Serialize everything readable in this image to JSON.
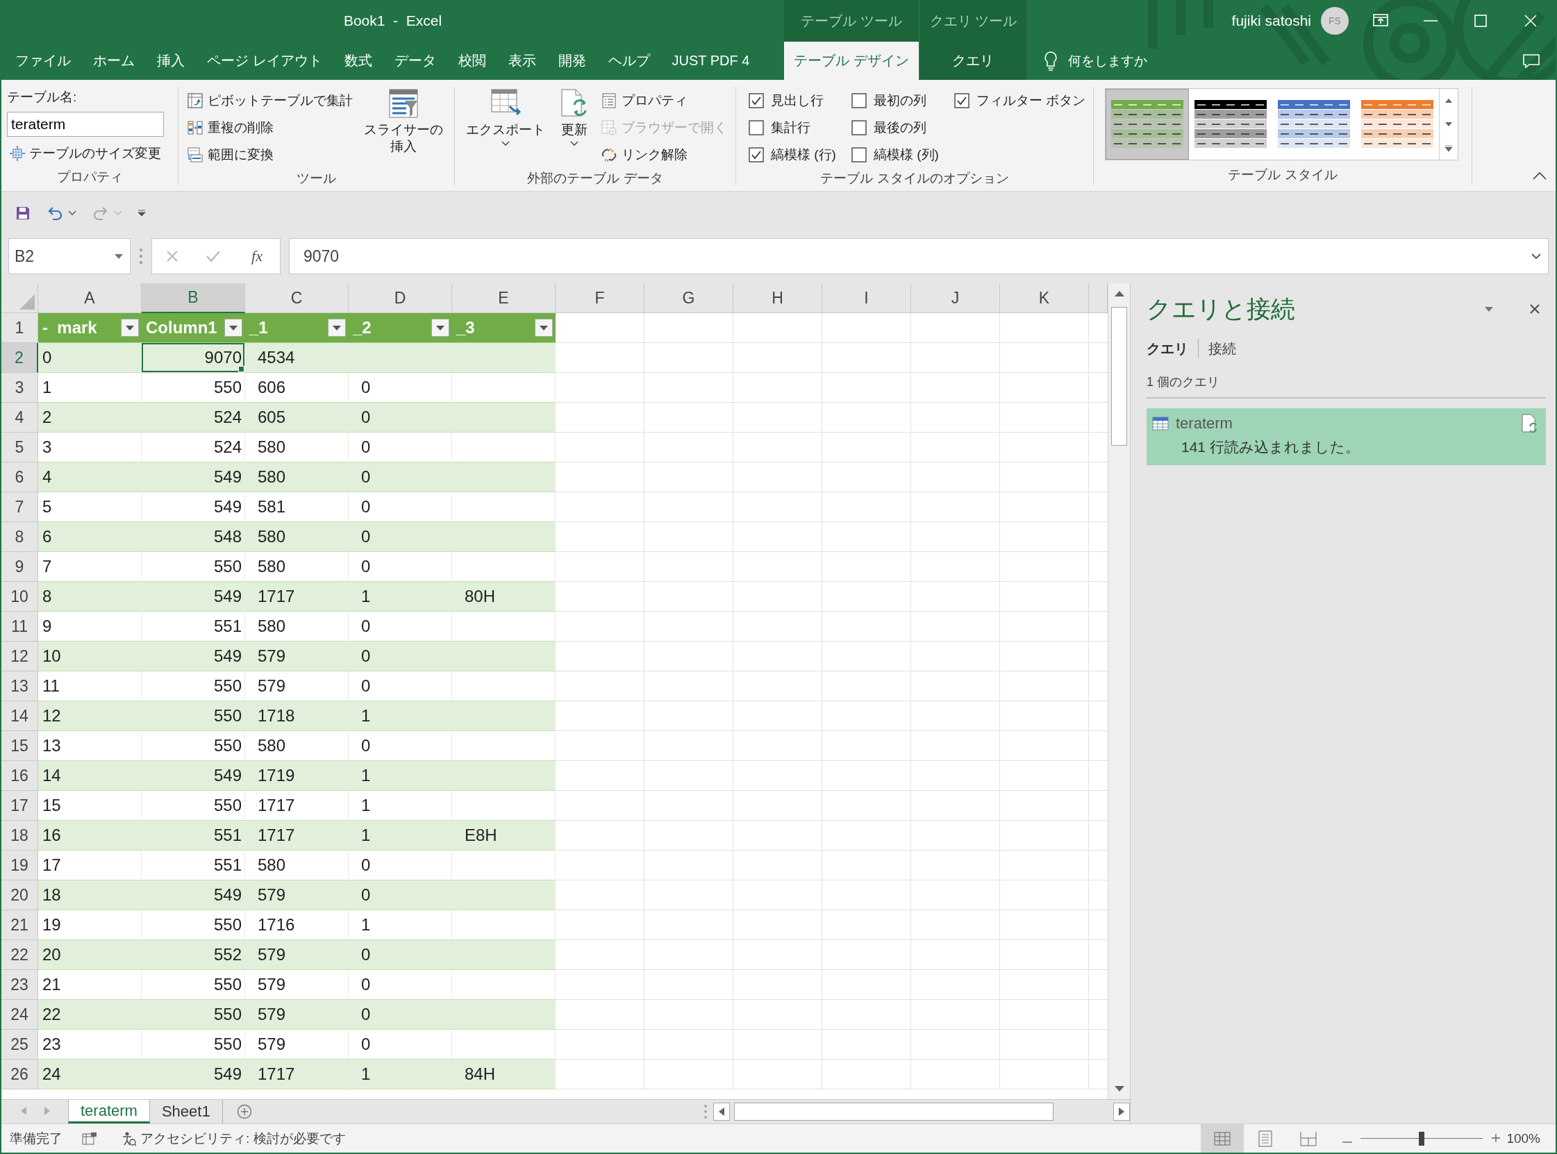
{
  "window": {
    "title": "Book1  -  Excel",
    "user_name": "fujiki satoshi",
    "avatar_initials": "FS"
  },
  "ribbon_tabs": [
    {
      "label": "ファイル",
      "selected": false
    },
    {
      "label": "ホーム",
      "selected": false
    },
    {
      "label": "挿入",
      "selected": false
    },
    {
      "label": "ページ レイアウト",
      "selected": false
    },
    {
      "label": "数式",
      "selected": false
    },
    {
      "label": "データ",
      "selected": false
    },
    {
      "label": "校閲",
      "selected": false
    },
    {
      "label": "表示",
      "selected": false
    },
    {
      "label": "開発",
      "selected": false
    },
    {
      "label": "ヘルプ",
      "selected": false
    },
    {
      "label": "JUST PDF 4",
      "selected": false
    }
  ],
  "context_groups": [
    {
      "label": "テーブル ツール",
      "tabs": [
        {
          "label": "テーブル デザイン",
          "selected": true
        }
      ]
    },
    {
      "label": "クエリ ツール",
      "tabs": [
        {
          "label": "クエリ",
          "selected": false
        }
      ]
    }
  ],
  "tell_me": {
    "placeholder": "何をしますか"
  },
  "ribbon_groups": [
    {
      "kind": "table_name",
      "label": "プロパティ",
      "field_label": "テーブル名:",
      "field_value": "teraterm",
      "button": "テーブルのサイズ変更"
    },
    {
      "kind": "commands",
      "label": "ツール",
      "items": [
        {
          "kind": "small",
          "label": "ピボットテーブルで集計",
          "disabled": false
        },
        {
          "kind": "small",
          "label": "重複の削除",
          "disabled": false
        },
        {
          "kind": "small",
          "label": "範囲に変換",
          "disabled": false
        },
        {
          "kind": "large",
          "lines": [
            "スライサーの",
            "挿入"
          ],
          "menu": false
        }
      ]
    },
    {
      "kind": "commands",
      "label": "外部のテーブル データ",
      "items": [
        {
          "kind": "large",
          "lines": [
            "エクスポート"
          ],
          "menu": true
        },
        {
          "kind": "large",
          "lines": [
            "更新"
          ],
          "menu": true
        },
        {
          "kind": "small",
          "label": "プロパティ",
          "disabled": false
        },
        {
          "kind": "small",
          "label": "ブラウザーで開く",
          "disabled": true
        },
        {
          "kind": "small",
          "label": "リンク解除",
          "disabled": false
        }
      ]
    },
    {
      "kind": "options",
      "label": "テーブル スタイルのオプション",
      "options": [
        {
          "label": "見出し行",
          "checked": true
        },
        {
          "label": "集計行",
          "checked": false
        },
        {
          "label": "縞模様 (行)",
          "checked": true
        },
        {
          "label": "最初の列",
          "checked": false
        },
        {
          "label": "最後の列",
          "checked": false
        },
        {
          "label": "縞模様 (列)",
          "checked": false
        },
        {
          "label": "フィルター ボタン",
          "checked": true
        }
      ]
    },
    {
      "kind": "gallery",
      "label": "テーブル スタイル",
      "styles": [
        {
          "color": "#70ad47",
          "selected": true
        },
        {
          "color": "#000000",
          "selected": false
        },
        {
          "color": "#4472c4",
          "selected": false
        },
        {
          "color": "#ed7d31",
          "selected": false
        }
      ]
    }
  ],
  "quick_access": [
    {
      "kind": "save",
      "disabled": false
    },
    {
      "kind": "undo",
      "disabled": false
    },
    {
      "kind": "redo",
      "disabled": true
    },
    {
      "kind": "customize",
      "disabled": false
    }
  ],
  "formula_bar": {
    "name_box": "B2",
    "function_button": "fx",
    "formula": "9070"
  },
  "grid": {
    "columns": [
      {
        "letter": "A",
        "selected": false
      },
      {
        "letter": "B",
        "selected": true
      },
      {
        "letter": "C",
        "selected": false
      },
      {
        "letter": "D",
        "selected": false
      },
      {
        "letter": "E",
        "selected": false
      },
      {
        "letter": "F",
        "selected": false
      },
      {
        "letter": "G",
        "selected": false
      },
      {
        "letter": "H",
        "selected": false
      },
      {
        "letter": "I",
        "selected": false
      },
      {
        "letter": "J",
        "selected": false
      },
      {
        "letter": "K",
        "selected": false
      }
    ]
  },
  "table": {
    "header_row": "1",
    "columns": [
      {
        "header": "-  mark",
        "kind": "text"
      },
      {
        "header": "Column1",
        "kind": "number"
      },
      {
        "header": "_1",
        "kind": "text"
      },
      {
        "header": "_2",
        "kind": "text"
      },
      {
        "header": "_3",
        "kind": "text"
      }
    ],
    "rows": [
      {
        "number": "2",
        "selected": true,
        "cells": [
          "0",
          "9070",
          "4534"
        ]
      },
      {
        "number": "3",
        "selected": false,
        "cells": [
          "1",
          "550",
          "606",
          "0"
        ]
      },
      {
        "number": "4",
        "selected": false,
        "cells": [
          "2",
          "524",
          "605",
          "0"
        ]
      },
      {
        "number": "5",
        "selected": false,
        "cells": [
          "3",
          "524",
          "580",
          "0"
        ]
      },
      {
        "number": "6",
        "selected": false,
        "cells": [
          "4",
          "549",
          "580",
          "0"
        ]
      },
      {
        "number": "7",
        "selected": false,
        "cells": [
          "5",
          "549",
          "581",
          "0"
        ]
      },
      {
        "number": "8",
        "selected": false,
        "cells": [
          "6",
          "548",
          "580",
          "0"
        ]
      },
      {
        "number": "9",
        "selected": false,
        "cells": [
          "7",
          "550",
          "580",
          "0"
        ]
      },
      {
        "number": "10",
        "selected": false,
        "cells": [
          "8",
          "549",
          "1717",
          "1",
          "80H"
        ]
      },
      {
        "number": "11",
        "selected": false,
        "cells": [
          "9",
          "551",
          "580",
          "0"
        ]
      },
      {
        "number": "12",
        "selected": false,
        "cells": [
          "10",
          "549",
          "579",
          "0"
        ]
      },
      {
        "number": "13",
        "selected": false,
        "cells": [
          "11",
          "550",
          "579",
          "0"
        ]
      },
      {
        "number": "14",
        "selected": false,
        "cells": [
          "12",
          "550",
          "1718",
          "1"
        ]
      },
      {
        "number": "15",
        "selected": false,
        "cells": [
          "13",
          "550",
          "580",
          "0"
        ]
      },
      {
        "number": "16",
        "selected": false,
        "cells": [
          "14",
          "549",
          "1719",
          "1"
        ]
      },
      {
        "number": "17",
        "selected": false,
        "cells": [
          "15",
          "550",
          "1717",
          "1"
        ]
      },
      {
        "number": "18",
        "selected": false,
        "cells": [
          "16",
          "551",
          "1717",
          "1",
          "E8H"
        ]
      },
      {
        "number": "19",
        "selected": false,
        "cells": [
          "17",
          "551",
          "580",
          "0"
        ]
      },
      {
        "number": "20",
        "selected": false,
        "cells": [
          "18",
          "549",
          "579",
          "0"
        ]
      },
      {
        "number": "21",
        "selected": false,
        "cells": [
          "19",
          "550",
          "1716",
          "1"
        ]
      },
      {
        "number": "22",
        "selected": false,
        "cells": [
          "20",
          "552",
          "579",
          "0"
        ]
      },
      {
        "number": "23",
        "selected": false,
        "cells": [
          "21",
          "550",
          "579",
          "0"
        ]
      },
      {
        "number": "24",
        "selected": false,
        "cells": [
          "22",
          "550",
          "579",
          "0"
        ]
      },
      {
        "number": "25",
        "selected": false,
        "cells": [
          "23",
          "550",
          "579",
          "0"
        ]
      },
      {
        "number": "26",
        "selected": false,
        "cells": [
          "24",
          "549",
          "1717",
          "1",
          "84H"
        ]
      }
    ]
  },
  "sheet_tabs": [
    {
      "label": "teraterm",
      "selected": true
    },
    {
      "label": "Sheet1",
      "selected": false
    }
  ],
  "query_pane": {
    "title": "クエリと接続",
    "tabs": [
      {
        "label": "クエリ",
        "selected": true
      },
      {
        "label": "接続",
        "selected": false
      }
    ],
    "count": "1 個のクエリ",
    "queries": [
      {
        "name": "teraterm",
        "status": "141 行読み込まれました。"
      }
    ]
  },
  "status_bar": {
    "mode": "準備完了",
    "accessibility": "アクセシビリティ: 検討が必要です",
    "views": [
      {
        "kind": "normal",
        "selected": true
      },
      {
        "kind": "page_layout",
        "selected": false
      },
      {
        "kind": "page_break",
        "selected": false
      }
    ],
    "zoom": {
      "level": 0.5,
      "reading": "100%"
    }
  }
}
